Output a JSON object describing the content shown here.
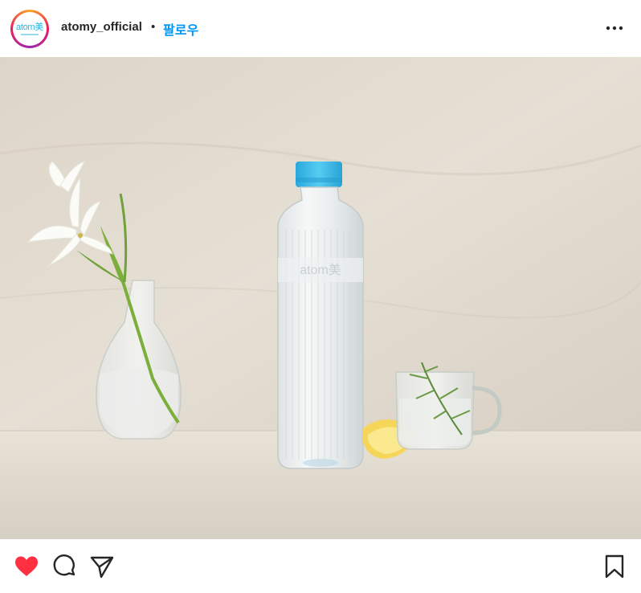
{
  "header": {
    "avatar_logo": "atom美",
    "username": "atomy_official",
    "separator": "•",
    "follow_label": "팔로우",
    "more_icon": "more-horizontal-icon"
  },
  "post": {
    "image_alt": "Atomy water bottle with lily in vase, lemon slice and glass mug with rosemary",
    "bottle_brand": "atom美"
  },
  "actions": {
    "like_icon": "heart-filled-icon",
    "comment_icon": "comment-icon",
    "share_icon": "share-icon",
    "save_icon": "bookmark-icon"
  },
  "colors": {
    "accent": "#0095f6",
    "like": "#ff3040",
    "cap": "#3cbbe8"
  }
}
